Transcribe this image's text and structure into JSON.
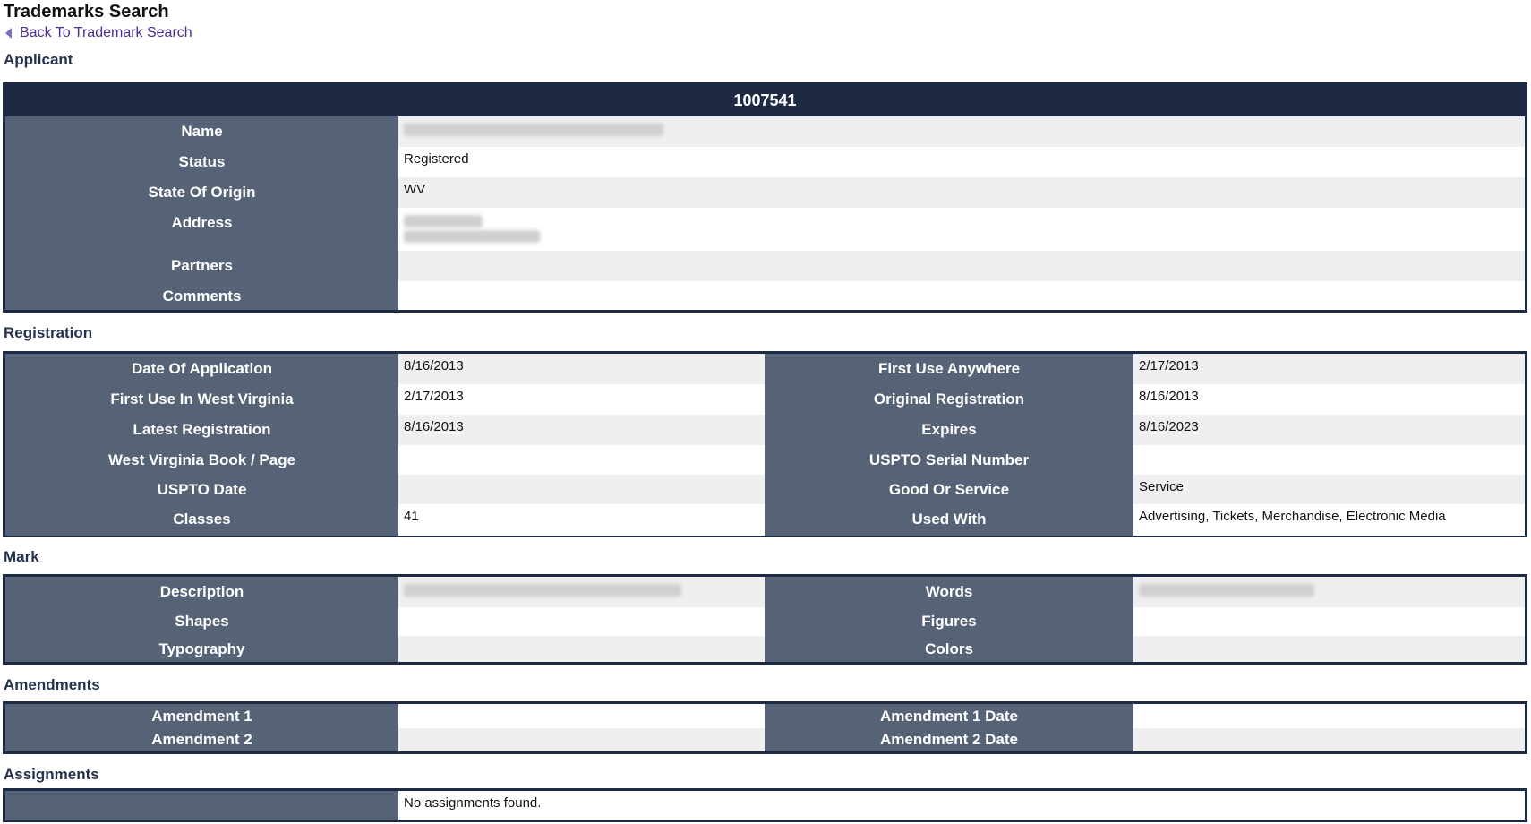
{
  "page": {
    "title": "Trademarks Search",
    "back_link": "Back To Trademark Search"
  },
  "sections": {
    "applicant": "Applicant",
    "registration": "Registration",
    "mark": "Mark",
    "amendments": "Amendments",
    "assignments": "Assignments"
  },
  "applicant": {
    "id": "1007541",
    "labels": {
      "name": "Name",
      "status": "Status",
      "state": "State Of Origin",
      "address": "Address",
      "partners": "Partners",
      "comments": "Comments"
    },
    "values": {
      "name": "",
      "status": "Registered",
      "state": "WV",
      "address_line1": "",
      "address_line2": "",
      "partners": "",
      "comments": ""
    }
  },
  "registration": {
    "rows": [
      {
        "l": "Date Of Application",
        "v": "8/16/2013",
        "l2": "First Use Anywhere",
        "v2": "2/17/2013"
      },
      {
        "l": "First Use In West Virginia",
        "v": "2/17/2013",
        "l2": "Original Registration",
        "v2": "8/16/2013"
      },
      {
        "l": "Latest Registration",
        "v": "8/16/2013",
        "l2": "Expires",
        "v2": "8/16/2023"
      },
      {
        "l": "West Virginia Book / Page",
        "v": "",
        "l2": "USPTO Serial Number",
        "v2": ""
      },
      {
        "l": "USPTO Date",
        "v": "",
        "l2": "Good Or Service",
        "v2": "Service"
      },
      {
        "l": "Classes",
        "v": "41",
        "l2": "Used With",
        "v2": "Advertising, Tickets, Merchandise, Electronic Media"
      }
    ]
  },
  "mark": {
    "rows": [
      {
        "l": "Description",
        "v": "",
        "l2": "Words",
        "v2": ""
      },
      {
        "l": "Shapes",
        "v": "",
        "l2": "Figures",
        "v2": ""
      },
      {
        "l": "Typography",
        "v": "",
        "l2": "Colors",
        "v2": ""
      }
    ]
  },
  "amendments": {
    "rows": [
      {
        "l": "Amendment 1",
        "v": "",
        "l2": "Amendment 1 Date",
        "v2": ""
      },
      {
        "l": "Amendment 2",
        "v": "",
        "l2": "Amendment 2 Date",
        "v2": ""
      }
    ]
  },
  "assignments": {
    "label": "",
    "value": "No assignments found."
  }
}
